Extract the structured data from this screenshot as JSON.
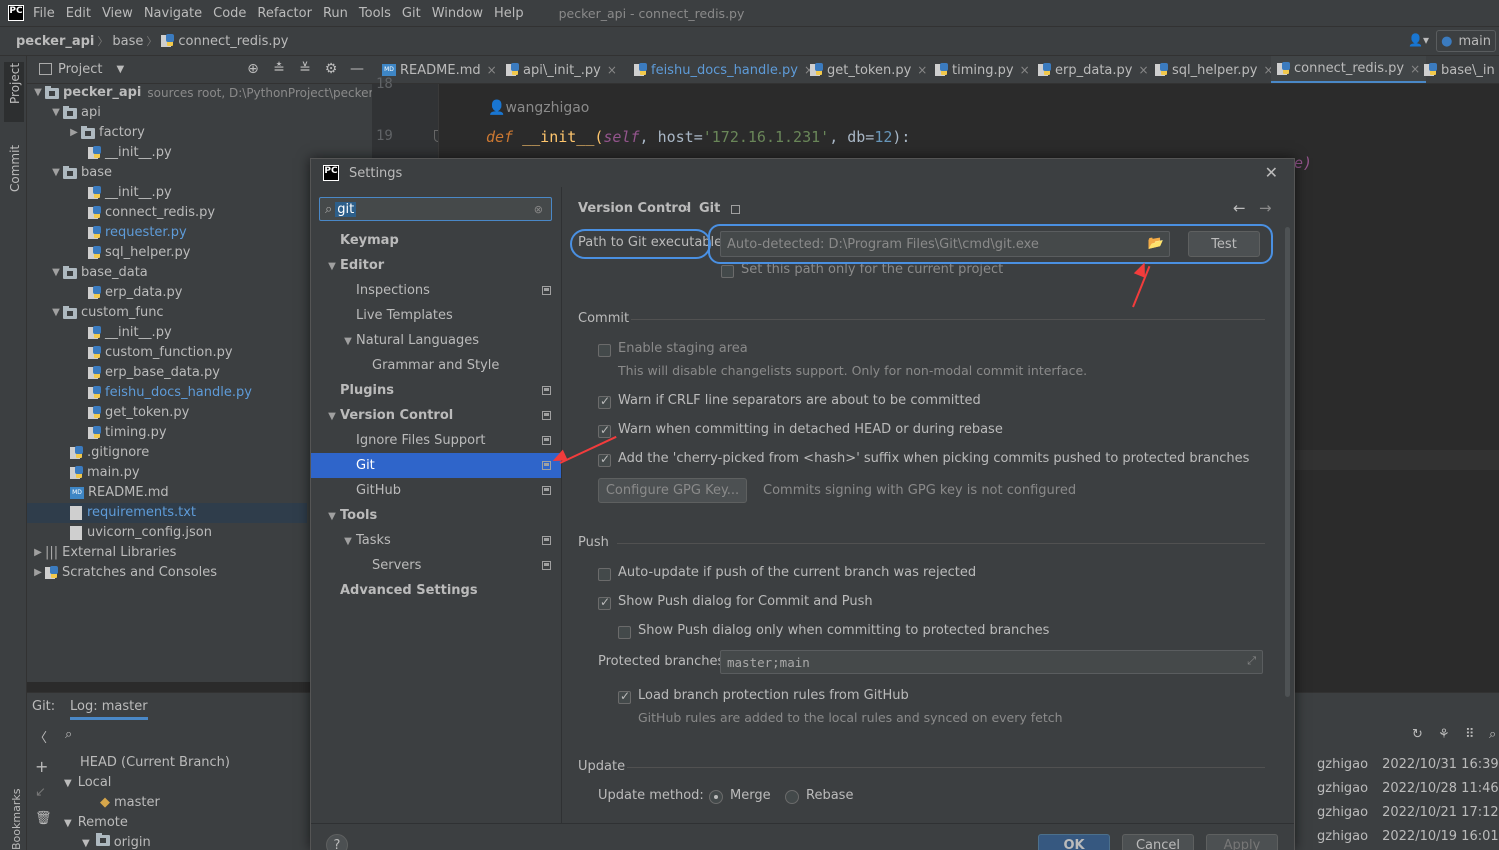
{
  "menubar": {
    "logo": "PC",
    "items": [
      "File",
      "Edit",
      "View",
      "Navigate",
      "Code",
      "Refactor",
      "Run",
      "Tools",
      "Git",
      "Window",
      "Help"
    ],
    "window_title": "pecker_api - connect_redis.py"
  },
  "navbar": {
    "project": "pecker_api",
    "folder": "base",
    "file": "connect_redis.py",
    "branch": "main"
  },
  "leftstrip": {
    "project_label": "Project",
    "commit_label": "Commit",
    "bookmarks_label": "Bookmarks"
  },
  "project_panel": {
    "title": "Project",
    "tree": [
      {
        "label": "pecker_api",
        "extra": "sources root,  D:\\PythonProject\\pecker_api"
      },
      {
        "label": "api"
      },
      {
        "label": "factory"
      },
      {
        "label": "__init__.py"
      },
      {
        "label": "base"
      },
      {
        "label": "__init__.py"
      },
      {
        "label": "connect_redis.py"
      },
      {
        "label": "requester.py"
      },
      {
        "label": "sql_helper.py"
      },
      {
        "label": "base_data"
      },
      {
        "label": "erp_data.py"
      },
      {
        "label": "custom_func"
      },
      {
        "label": "__init__.py"
      },
      {
        "label": "custom_function.py"
      },
      {
        "label": "erp_base_data.py"
      },
      {
        "label": "feishu_docs_handle.py"
      },
      {
        "label": "get_token.py"
      },
      {
        "label": "timing.py"
      },
      {
        "label": ".gitignore"
      },
      {
        "label": "main.py"
      },
      {
        "label": "README.md"
      },
      {
        "label": "requirements.txt"
      },
      {
        "label": "uvicorn_config.json"
      },
      {
        "label": "External Libraries"
      },
      {
        "label": "Scratches and Consoles"
      }
    ]
  },
  "tabs": [
    "README.md",
    "api\\_init_.py",
    "feishu_docs_handle.py",
    "get_token.py",
    "timing.py",
    "erp_data.py",
    "sql_helper.py",
    "connect_redis.py",
    "base\\_in"
  ],
  "editor": {
    "line_18": "18",
    "line_19": "19",
    "author": "wangzhigao",
    "code_def": "def",
    "code_fn": " __init__(",
    "code_self": "self",
    "code_rest1": ", host=",
    "code_str": "'172.16.1.231'",
    "code_rest2": ", db=",
    "code_num": "12",
    "code_end": "):",
    "code_tail": "e)"
  },
  "git_panel": {
    "tab_git": "Git:",
    "tab_log": "Log: master",
    "head": "HEAD (Current Branch)",
    "local": "Local",
    "master": "master",
    "remote": "Remote",
    "origin": "origin",
    "log_rows": [
      {
        "author": "gzhigao",
        "date": "2022/10/31 16:39"
      },
      {
        "author": "gzhigao",
        "date": "2022/10/28 11:46"
      },
      {
        "author": "gzhigao",
        "date": "2022/10/21 17:12"
      },
      {
        "author": "gzhigao",
        "date": "2022/10/19 16:01"
      }
    ]
  },
  "dialog": {
    "title": "Settings",
    "search_value": "git",
    "tree": [
      {
        "label": "Keymap"
      },
      {
        "label": "Editor"
      },
      {
        "label": "Inspections"
      },
      {
        "label": "Live Templates"
      },
      {
        "label": "Natural Languages"
      },
      {
        "label": "Grammar and Style"
      },
      {
        "label": "Plugins"
      },
      {
        "label": "Version Control"
      },
      {
        "label": "Ignore Files Support"
      },
      {
        "label": "Git"
      },
      {
        "label": "GitHub"
      },
      {
        "label": "Tools"
      },
      {
        "label": "Tasks"
      },
      {
        "label": "Servers"
      },
      {
        "label": "Advanced Settings"
      }
    ],
    "breadcrumb_parent": "Version Control",
    "breadcrumb_sep": "›",
    "breadcrumb_current": "Git",
    "path_label": "Path to Git executable:",
    "path_placeholder": "Auto-detected: D:\\Program Files\\Git\\cmd\\git.exe",
    "test_button": "Test",
    "set_path_only": "Set this path only for the current project",
    "commit_section": "Commit",
    "enable_staging": "Enable staging area",
    "staging_hint": "This will disable changelists support. Only for non-modal commit interface.",
    "warn_crlf": "Warn if CRLF line separators are about to be committed",
    "warn_detached": "Warn when committing in detached HEAD or during rebase",
    "cherry_picked": "Add the 'cherry-picked from <hash>' suffix when picking commits pushed to protected branches",
    "configure_gpg": "Configure GPG Key...",
    "gpg_hint": "Commits signing with GPG key is not configured",
    "push_section": "Push",
    "auto_update": "Auto-update if push of the current branch was rejected",
    "show_push": "Show Push dialog for Commit and Push",
    "show_push_protected": "Show Push dialog only when committing to protected branches",
    "protected_label": "Protected branches:",
    "protected_value": "master;main",
    "load_rules": "Load branch protection rules from GitHub",
    "rules_hint": "GitHub rules are added to the local rules and synced on every fetch",
    "update_section": "Update",
    "update_method": "Update method:",
    "merge": "Merge",
    "rebase": "Rebase",
    "ok": "OK",
    "cancel": "Cancel",
    "apply": "Apply",
    "help": "?"
  },
  "colors": {
    "accent": "#4a88c7",
    "selection": "#2f65ca",
    "annotation": "#f23c3c",
    "oval": "#4a90e2"
  }
}
